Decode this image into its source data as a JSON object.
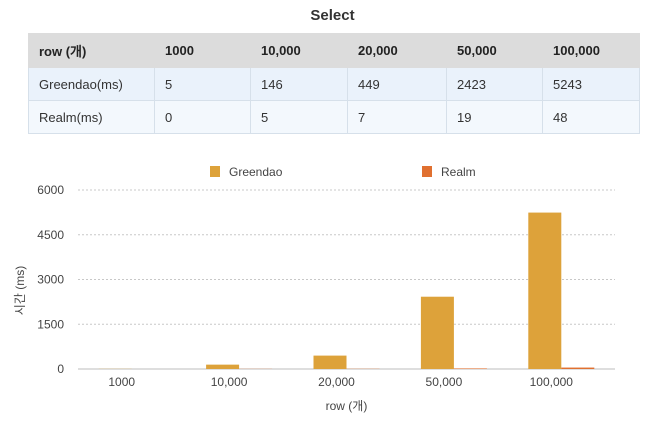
{
  "title": "Select",
  "table": {
    "headers": [
      "row (개)",
      "1000",
      "10,000",
      "20,000",
      "50,000",
      "100,000"
    ],
    "rows": [
      [
        "Greendao(ms)",
        "5",
        "146",
        "449",
        "2423",
        "5243"
      ],
      [
        "Realm(ms)",
        "0",
        "5",
        "7",
        "19",
        "48"
      ]
    ]
  },
  "chart_data": {
    "type": "bar",
    "categories": [
      "1000",
      "10,000",
      "20,000",
      "50,000",
      "100,000"
    ],
    "series": [
      {
        "name": "Greendao",
        "values": [
          5,
          146,
          449,
          2423,
          5243
        ],
        "color": "#dda23a"
      },
      {
        "name": "Realm",
        "values": [
          0,
          5,
          7,
          19,
          48
        ],
        "color": "#e07030"
      }
    ],
    "xlabel": "row (개)",
    "ylabel": "시간 (ms)",
    "ylim": [
      0,
      6000
    ],
    "yticks": [
      0,
      1500,
      3000,
      4500,
      6000
    ],
    "grid": true,
    "legend_position": "top"
  }
}
